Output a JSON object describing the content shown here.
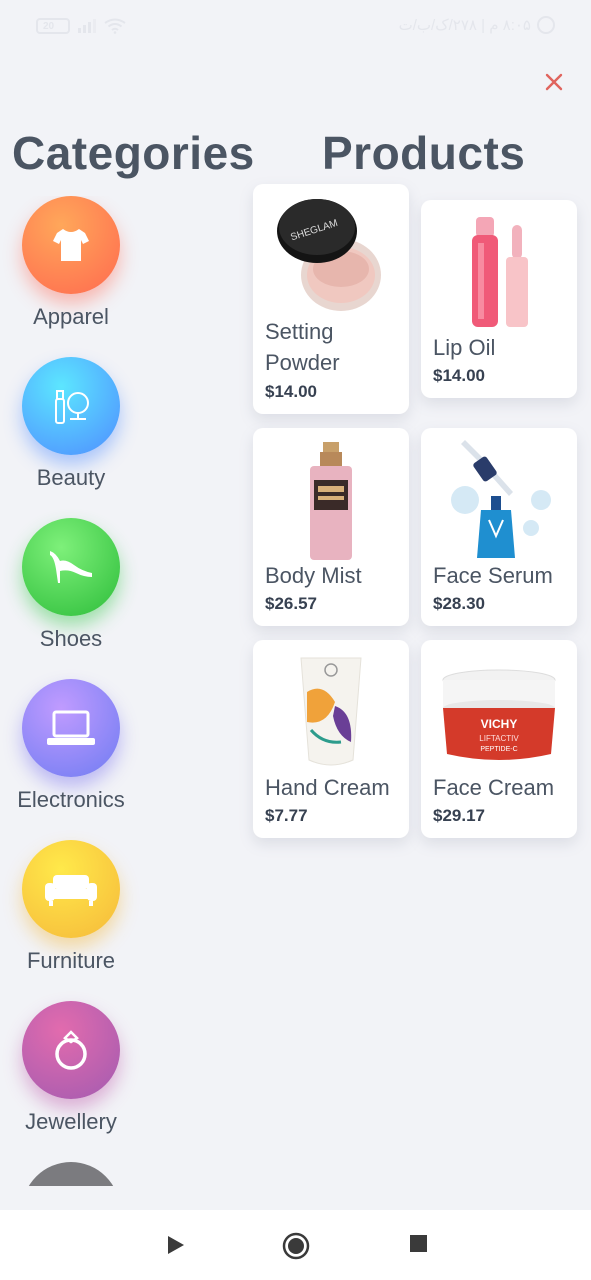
{
  "status_bar": {
    "battery": "20",
    "right_text": "۸:۰۵ م | ۲۷۸/ک/ب/ت"
  },
  "header": {
    "categories_title": "Categories",
    "products_title": "Products",
    "close_icon": "close-icon"
  },
  "categories": [
    {
      "label": "Apparel",
      "icon": "tshirt-icon",
      "color": "#ff7a59"
    },
    {
      "label": "Beauty",
      "icon": "cosmetics-icon",
      "color": "#4fb3ff"
    },
    {
      "label": "Shoes",
      "icon": "high-heel-icon",
      "color": "#3fd15a"
    },
    {
      "label": "Electronics",
      "icon": "laptop-icon",
      "color": "#8f7bf5"
    },
    {
      "label": "Furniture",
      "icon": "sofa-icon",
      "color": "#f7cc3a"
    },
    {
      "label": "Jewellery",
      "icon": "ring-icon",
      "color": "#c85aa4"
    }
  ],
  "products": [
    {
      "name_line1": "Setting",
      "name_line2": "Powder",
      "price": "$14.00",
      "image": "setting-powder-image"
    },
    {
      "name": "Lip Oil",
      "price": "$14.00",
      "image": "lip-oil-image"
    },
    {
      "name": "Body Mist",
      "price": "$26.57",
      "image": "body-mist-image"
    },
    {
      "name": "Face Serum",
      "price": "$28.30",
      "image": "face-serum-image"
    },
    {
      "name": "Hand Cream",
      "price": "$7.77",
      "image": "hand-cream-image"
    },
    {
      "name": "Face Cream",
      "price": "$29.17",
      "image": "face-cream-image"
    }
  ],
  "product_texts": {
    "powder_brand": "SHEGLAM",
    "vichy_line1": "VICHY",
    "vichy_line2": "LIFTACTIV",
    "vichy_line3": "PEPTIDE-C"
  },
  "navbar": {
    "back": "play-icon",
    "home": "circle-home-icon",
    "recents": "square-icon"
  }
}
